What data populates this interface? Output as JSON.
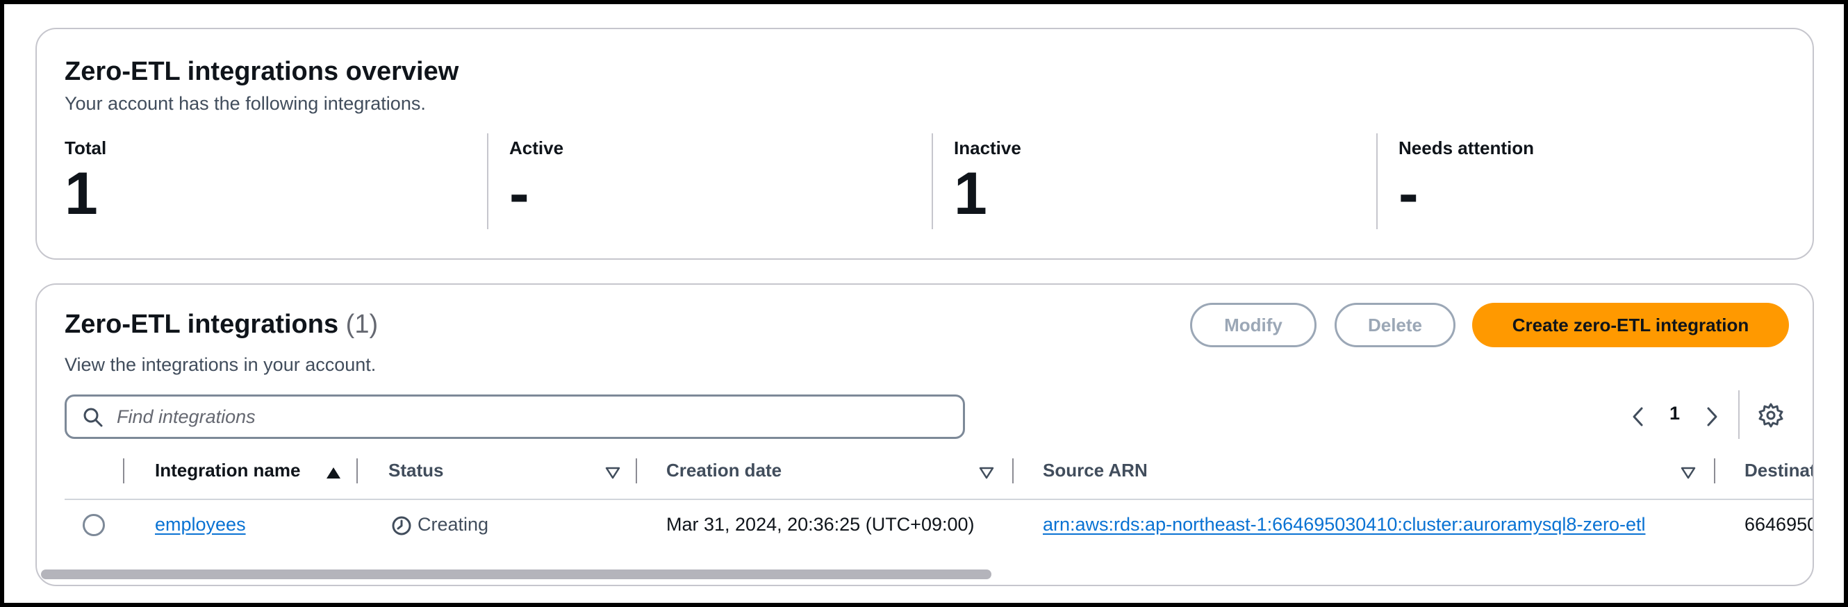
{
  "overview": {
    "title": "Zero-ETL integrations overview",
    "subtitle": "Your account has the following integrations.",
    "stats": [
      {
        "label": "Total",
        "value": "1"
      },
      {
        "label": "Active",
        "value": "-"
      },
      {
        "label": "Inactive",
        "value": "1"
      },
      {
        "label": "Needs attention",
        "value": "-"
      }
    ]
  },
  "integrations": {
    "title": "Zero-ETL integrations",
    "count": "(1)",
    "subtitle": "View the integrations in your account.",
    "buttons": {
      "modify": "Modify",
      "delete": "Delete",
      "create": "Create zero-ETL integration"
    },
    "search": {
      "placeholder": "Find integrations",
      "value": ""
    },
    "pagination": {
      "current_page": "1"
    },
    "columns": [
      "Integration name",
      "Status",
      "Creation date",
      "Source ARN",
      "Destinat"
    ],
    "rows": [
      {
        "name": "employees",
        "status": "Creating",
        "creation_date": "Mar 31, 2024, 20:36:25 (UTC+09:00)",
        "source_arn": "arn:aws:rds:ap-northeast-1:664695030410:cluster:auroramysql8-zero-etl",
        "destination": "6646950"
      }
    ]
  },
  "colors": {
    "primary_button": "#ff9900",
    "link": "#0972d3",
    "disabled": "#9ba7b6",
    "border": "#c6c6cd"
  },
  "icons": [
    "search-icon",
    "chevron-left-icon",
    "chevron-right-icon",
    "settings-gear-icon",
    "sort-ascending-icon",
    "sort-descending-icon",
    "clock-icon"
  ]
}
